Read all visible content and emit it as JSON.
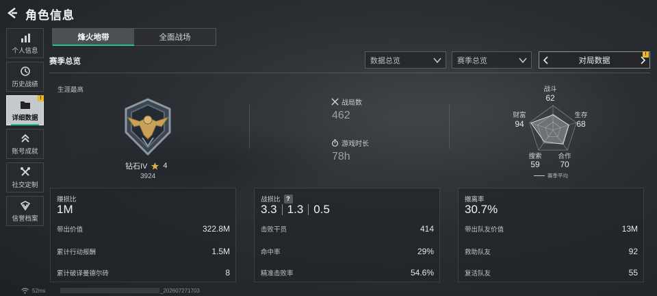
{
  "header": {
    "title": "角色信息"
  },
  "sidebar": {
    "items": [
      {
        "label": "个人信息",
        "icon": "bar-chart-icon"
      },
      {
        "label": "历史战绩",
        "icon": "clock-icon"
      },
      {
        "label": "详细数据",
        "icon": "folder-icon",
        "active": true,
        "badge": "!"
      },
      {
        "label": "账号成就",
        "icon": "chevrons-up-icon"
      },
      {
        "label": "社交定制",
        "icon": "tools-icon"
      },
      {
        "label": "信誉档案",
        "icon": "diamond-badge-icon"
      }
    ]
  },
  "mode_tabs": [
    {
      "label": "烽火地带",
      "active": true
    },
    {
      "label": "全面战场",
      "active": false
    }
  ],
  "section_title": "赛季总览",
  "filters": {
    "data_scope": "数据总览",
    "season": "赛季总览",
    "pager_label": "对局数据",
    "pager_badge": "!"
  },
  "summary": {
    "career_label": "生涯最高",
    "rank_name": "钻石IV",
    "rank_stars": "4",
    "rank_score": "3924",
    "matches_label": "战局数",
    "matches_value": "462",
    "playtime_label": "游戏时长",
    "playtime_value": "78h"
  },
  "radar": {
    "legend": "赛季平均",
    "axes": [
      {
        "label": "战斗",
        "value": 62
      },
      {
        "label": "生存",
        "value": 68
      },
      {
        "label": "合作",
        "value": 70
      },
      {
        "label": "搜索",
        "value": 59
      },
      {
        "label": "财富",
        "value": 94
      }
    ]
  },
  "panels": {
    "profit": {
      "title": "赚损比",
      "value": "1M",
      "rows": [
        {
          "key": "带出价值",
          "value": "322.8M"
        },
        {
          "key": "累计行动报酬",
          "value": "1.5M"
        },
        {
          "key": "累计破译曼德尔砖",
          "value": "8"
        }
      ]
    },
    "combat": {
      "title": "战损比",
      "help": "?",
      "ratios": [
        "3.3",
        "1.3",
        "0.5"
      ],
      "rows": [
        {
          "key": "击败干员",
          "value": "414"
        },
        {
          "key": "命中率",
          "value": "29%"
        },
        {
          "key": "精准击败率",
          "value": "54.6%"
        }
      ]
    },
    "extract": {
      "title": "撤离率",
      "value": "30.7%",
      "rows": [
        {
          "key": "带出队友价值",
          "value": "13M"
        },
        {
          "key": "救助队友",
          "value": "92"
        },
        {
          "key": "复活队友",
          "value": "55"
        }
      ]
    }
  },
  "statusbar": {
    "ping": "52ms",
    "build": "_202607271703"
  },
  "colors": {
    "accent": "#18c98a",
    "badge": "#e9b82c",
    "emblem_gold": "#c9a15a"
  }
}
